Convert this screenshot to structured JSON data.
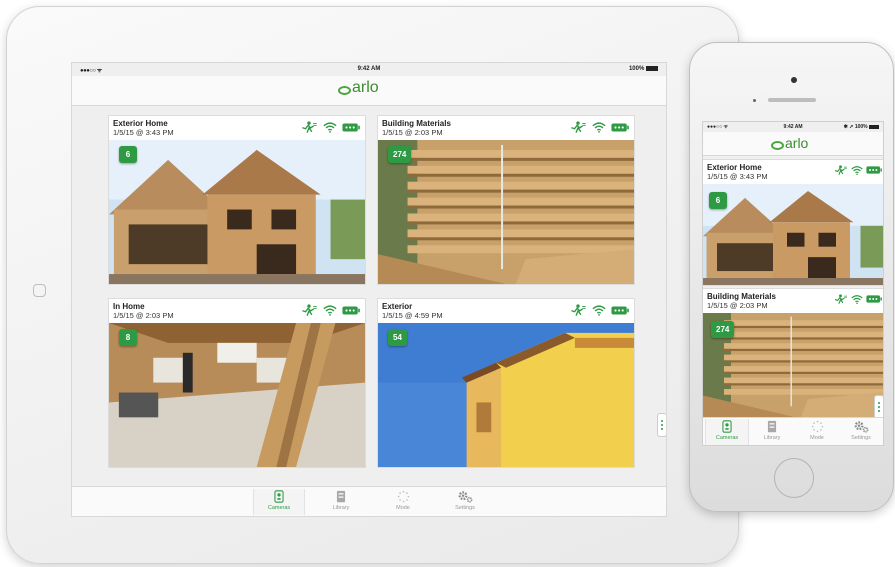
{
  "colors": {
    "brand_green": "#2e9a44",
    "logo_green": "#3b8d2f"
  },
  "tablet": {
    "status": {
      "carrier": "●●●○○ ᯤ",
      "time": "9:42 AM",
      "battery": "100%"
    },
    "logo_text": "arlo",
    "cameras": [
      {
        "name": "Exterior Home",
        "timestamp": "1/5/15 @ 3:43 PM",
        "count": "6",
        "scene": "house"
      },
      {
        "name": "Building Materials",
        "timestamp": "1/5/15 @ 2:03 PM",
        "count": "274",
        "scene": "lumber"
      },
      {
        "name": "In Home",
        "timestamp": "1/5/15 @ 2:03 PM",
        "count": "8",
        "scene": "interior"
      },
      {
        "name": "Exterior",
        "timestamp": "1/5/15 @ 4:59 PM",
        "count": "54",
        "scene": "wall"
      }
    ],
    "tabs": [
      {
        "label": "Cameras",
        "icon": "camera-icon",
        "active": true
      },
      {
        "label": "Library",
        "icon": "library-icon",
        "active": false
      },
      {
        "label": "Mode",
        "icon": "mode-icon",
        "active": false
      },
      {
        "label": "Settings",
        "icon": "settings-icon",
        "active": false
      }
    ]
  },
  "phone": {
    "status": {
      "carrier": "●●●○○ ᯤ",
      "time": "9:42 AM",
      "battery": "✱ ➚ 100%"
    },
    "logo_text": "arlo",
    "cameras": [
      {
        "name": "Exterior Home",
        "timestamp": "1/5/15 @ 3:43 PM",
        "count": "6"
      },
      {
        "name": "Building Materials",
        "timestamp": "1/5/15 @ 2:03 PM",
        "count": "274"
      }
    ],
    "tabs": [
      {
        "label": "Cameras",
        "icon": "camera-icon",
        "active": true
      },
      {
        "label": "Library",
        "icon": "library-icon",
        "active": false
      },
      {
        "label": "Mode",
        "icon": "mode-icon",
        "active": false
      },
      {
        "label": "Settings",
        "icon": "settings-icon",
        "active": false
      }
    ]
  }
}
